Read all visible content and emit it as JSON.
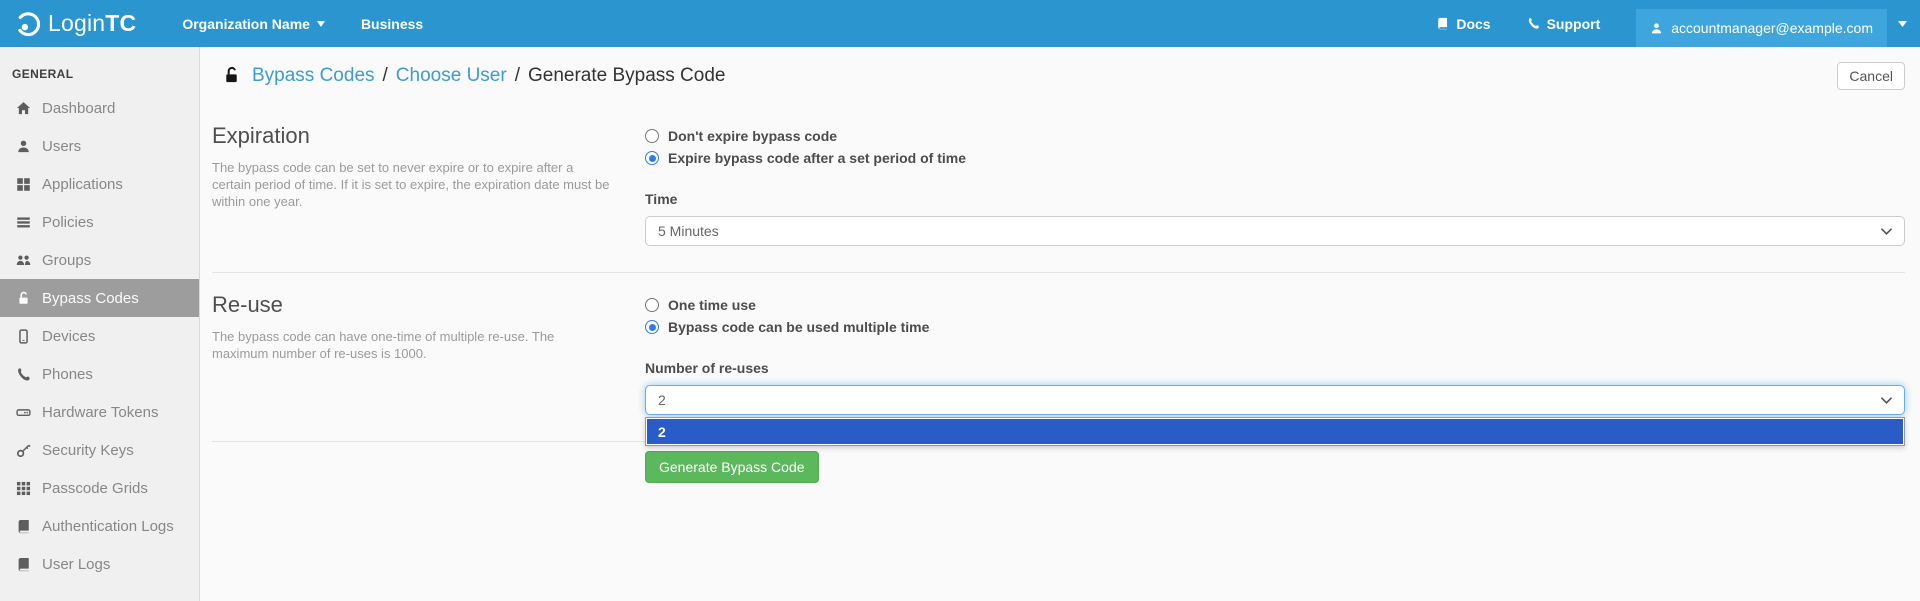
{
  "navbar": {
    "brand_login": "Login",
    "brand_tc": "TC",
    "org_dropdown": "Organization Name",
    "plan": "Business",
    "docs": "Docs",
    "support": "Support",
    "account_email": "accountmanager@example.com"
  },
  "sidebar": {
    "section": "GENERAL",
    "items": [
      {
        "label": "Dashboard",
        "icon": "home",
        "active": false
      },
      {
        "label": "Users",
        "icon": "user",
        "active": false
      },
      {
        "label": "Applications",
        "icon": "grid-large",
        "active": false
      },
      {
        "label": "Policies",
        "icon": "list",
        "active": false
      },
      {
        "label": "Groups",
        "icon": "users",
        "active": false
      },
      {
        "label": "Bypass Codes",
        "icon": "lock-open",
        "active": true
      },
      {
        "label": "Devices",
        "icon": "mobile",
        "active": false
      },
      {
        "label": "Phones",
        "icon": "phone",
        "active": false
      },
      {
        "label": "Hardware Tokens",
        "icon": "hdd",
        "active": false
      },
      {
        "label": "Security Keys",
        "icon": "key",
        "active": false
      },
      {
        "label": "Passcode Grids",
        "icon": "grid",
        "active": false
      },
      {
        "label": "Authentication Logs",
        "icon": "book",
        "active": false
      },
      {
        "label": "User Logs",
        "icon": "book",
        "active": false
      }
    ]
  },
  "header": {
    "breadcrumb": [
      {
        "label": "Bypass Codes",
        "link": true
      },
      {
        "label": "Choose User",
        "link": true
      },
      {
        "label": "Generate Bypass Code",
        "link": false
      }
    ],
    "cancel_label": "Cancel"
  },
  "form": {
    "expiration": {
      "title": "Expiration",
      "description": "The bypass code can be set to never expire or to expire after a certain period of time. If it is set to expire, the expiration date must be within one year.",
      "options": [
        "Don't expire bypass code",
        "Expire bypass code after a set period of time"
      ],
      "selected_option": 1,
      "time_label": "Time",
      "time_value": "5 Minutes"
    },
    "reuse": {
      "title": "Re-use",
      "description": "The bypass code can have one-time of multiple re-use. The maximum number of re-uses is 1000.",
      "options": [
        "One time use",
        "Bypass code can be used multiple time"
      ],
      "selected_option": 1,
      "number_label": "Number of re-uses",
      "number_value": "2",
      "dropdown_options": [
        "2"
      ],
      "dropdown_highlighted": 0
    },
    "submit_label": "Generate Bypass Code"
  },
  "colors": {
    "navbar_bg": "#2b95cf",
    "account_highlight": "#3ea6dc",
    "link_blue": "#3d9bd4",
    "active_item_bg": "#9d9d9d",
    "radio_selected": "#2f7de1",
    "focus_glow": "#66afe9",
    "option_highlight": "#2a5cc8",
    "button_green": "#5cb85c"
  }
}
